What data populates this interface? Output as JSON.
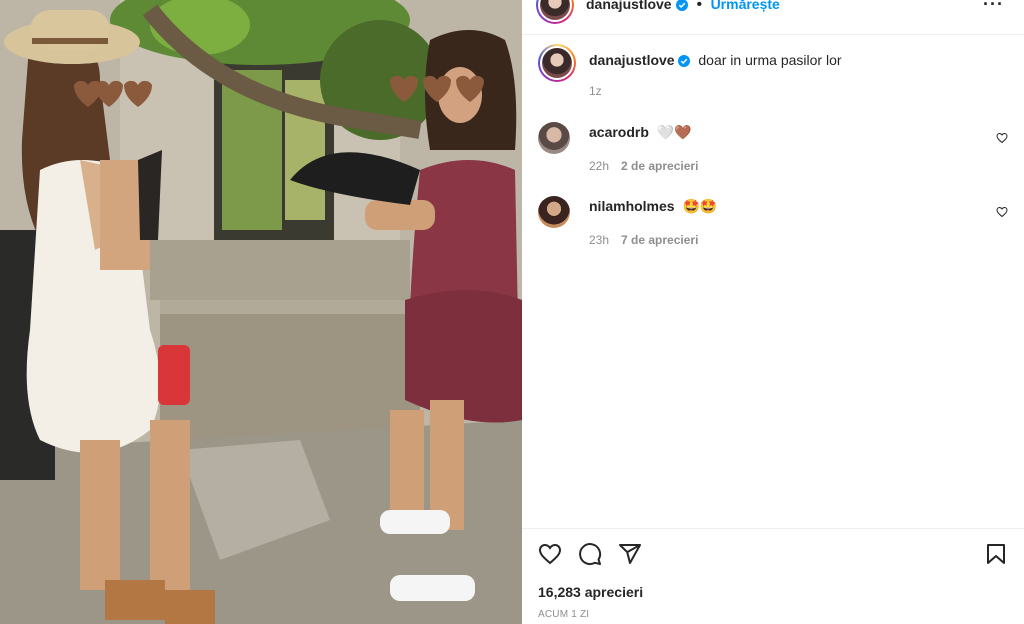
{
  "post": {
    "username": "danajustlove",
    "follow_label": "Urmărește",
    "separator": "•",
    "more_label": "···",
    "caption": {
      "username": "danajustlove",
      "text": "doar in urma pasilor lor",
      "time": "1z"
    }
  },
  "comments": [
    {
      "username": "acarodrb",
      "emoji": "🤍🤎",
      "time": "22h",
      "likes": "2 de aprecieri"
    },
    {
      "username": "nilamholmes",
      "emoji": "🤩🤩",
      "time": "23h",
      "likes": "7 de aprecieri"
    }
  ],
  "footer": {
    "likes": "16,283 aprecieri",
    "ago": "ACUM 1 ZI"
  },
  "icons": {
    "like": "heart-icon",
    "comment": "comment-icon",
    "share": "share-icon",
    "save": "bookmark-icon",
    "verified": "verified-badge-icon",
    "more": "more-options-icon"
  },
  "colors": {
    "accent": "#0095f6",
    "text": "#262626",
    "muted": "#8e8e8e",
    "divider": "#efefef"
  }
}
